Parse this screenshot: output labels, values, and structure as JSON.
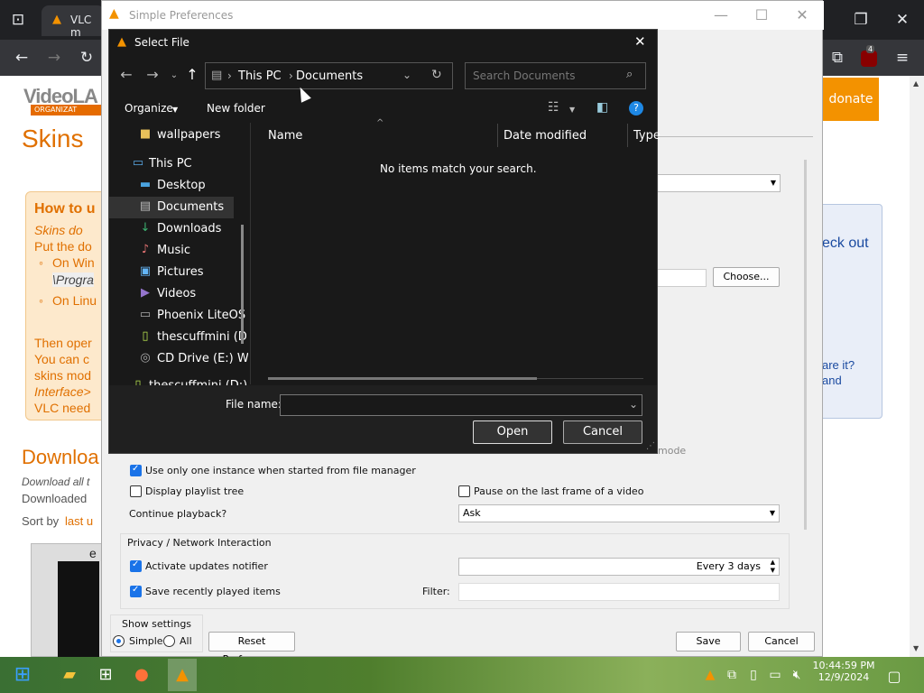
{
  "browser": {
    "tab_title": "VLC m",
    "notification_count": "4"
  },
  "webpage": {
    "logo_text": "VideoLA",
    "logo_sub": "ORGANIZAT",
    "title": "Skins",
    "donate": "donate",
    "howto": {
      "heading": "How to u",
      "line1": "Skins do",
      "line2": "Put the do",
      "bullet1": "On Win",
      "bullet1_path": "\\Progra",
      "bullet2": "On Linu",
      "line3": "Then oper",
      "line4": "You can c",
      "line5": "skins mod",
      "line6": "Interface>",
      "line7": "VLC need"
    },
    "right_panel": {
      "line1": "eck out",
      "line2": "are it?",
      "line3": "and"
    },
    "download_heading": "Downloa",
    "download_all": "Download all t",
    "downloaded": "Downloaded",
    "sort_by": "Sort by",
    "sort_link": "last u",
    "thumb_label": "e"
  },
  "prefs": {
    "title": "Simple Preferences",
    "choose_button": "Choose...",
    "mode_label": "mode",
    "one_instance": "Use only one instance when started from file manager",
    "display_playlist_tree": "Display playlist tree",
    "pause_last_frame": "Pause on the last frame of a video",
    "continue_playback": "Continue playback?",
    "continue_value": "Ask",
    "privacy_section": "Privacy / Network Interaction",
    "activate_updates": "Activate updates notifier",
    "updates_value": "Every 3 days",
    "save_recent": "Save recently played items",
    "filter_label": "Filter:",
    "show_settings": "Show settings",
    "simple": "Simple",
    "all": "All",
    "reset": "Reset Preferences",
    "save": "Save",
    "cancel": "Cancel"
  },
  "dialog": {
    "title": "Select File",
    "breadcrumb": [
      "This PC",
      "Documents"
    ],
    "search_placeholder": "Search Documents",
    "organize": "Organize",
    "new_folder": "New folder",
    "columns": [
      "Name",
      "Date modified",
      "Type"
    ],
    "empty_message": "No items match your search.",
    "tree": [
      {
        "label": "wallpapers",
        "icon": "folder-icon",
        "indent": 1
      },
      {
        "label": "This PC",
        "icon": "computer-icon",
        "indent": 0
      },
      {
        "label": "Desktop",
        "icon": "desktop-icon",
        "indent": 1
      },
      {
        "label": "Documents",
        "icon": "documents-icon",
        "indent": 1,
        "selected": true
      },
      {
        "label": "Downloads",
        "icon": "downloads-icon",
        "indent": 1
      },
      {
        "label": "Music",
        "icon": "music-icon",
        "indent": 1
      },
      {
        "label": "Pictures",
        "icon": "pictures-icon",
        "indent": 1
      },
      {
        "label": "Videos",
        "icon": "videos-icon",
        "indent": 1
      },
      {
        "label": "Phoenix LiteOS",
        "icon": "drive-icon",
        "indent": 1
      },
      {
        "label": "thescuffmini (D",
        "icon": "usb-drive-icon",
        "indent": 1
      },
      {
        "label": "CD Drive (E:) W",
        "icon": "cd-drive-icon",
        "indent": 1
      },
      {
        "label": "thescuffmini (D:)",
        "icon": "usb-drive-icon",
        "indent": 0
      }
    ],
    "file_name_label": "File name:",
    "file_name_value": "",
    "open": "Open",
    "cancel": "Cancel"
  },
  "taskbar": {
    "time": "10:44:59 PM",
    "date": "12/9/2024"
  }
}
